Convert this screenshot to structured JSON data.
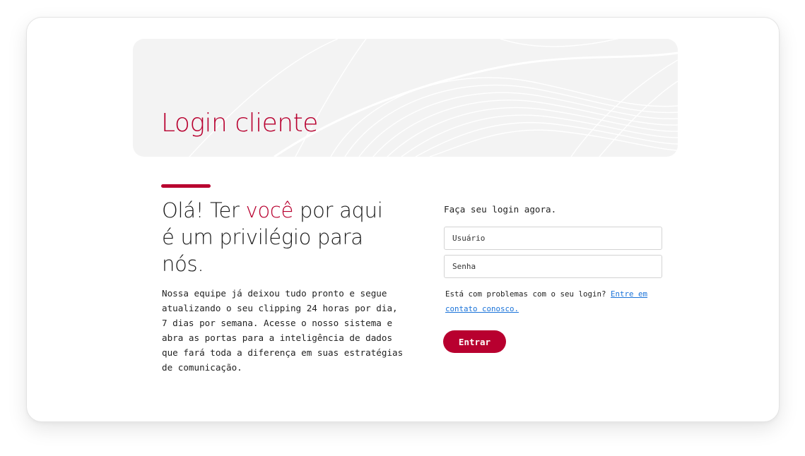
{
  "banner": {
    "title": "Login cliente"
  },
  "intro": {
    "headline_before": "Olá! Ter ",
    "headline_highlight": "você",
    "headline_after": " por aqui é um privilégio para nós.",
    "description": "Nossa equipe já deixou tudo pronto e segue atualizando o seu clipping 24 horas por dia, 7 dias por semana. Acesse o nosso sistema e abra as portas para a inteligência de dados que fará toda a diferença em suas estratégias de comunicação."
  },
  "login": {
    "heading": "Faça seu login agora.",
    "username_placeholder": "Usuário",
    "username_value": "",
    "password_placeholder": "Senha",
    "password_value": "",
    "help_text": "Está com problemas com o seu login? ",
    "help_link": "Entre em contato conosco.",
    "submit_label": "Entrar"
  },
  "colors": {
    "brand": "#b8002f",
    "link": "#1a73d9",
    "banner_bg": "#f3f3f3"
  }
}
